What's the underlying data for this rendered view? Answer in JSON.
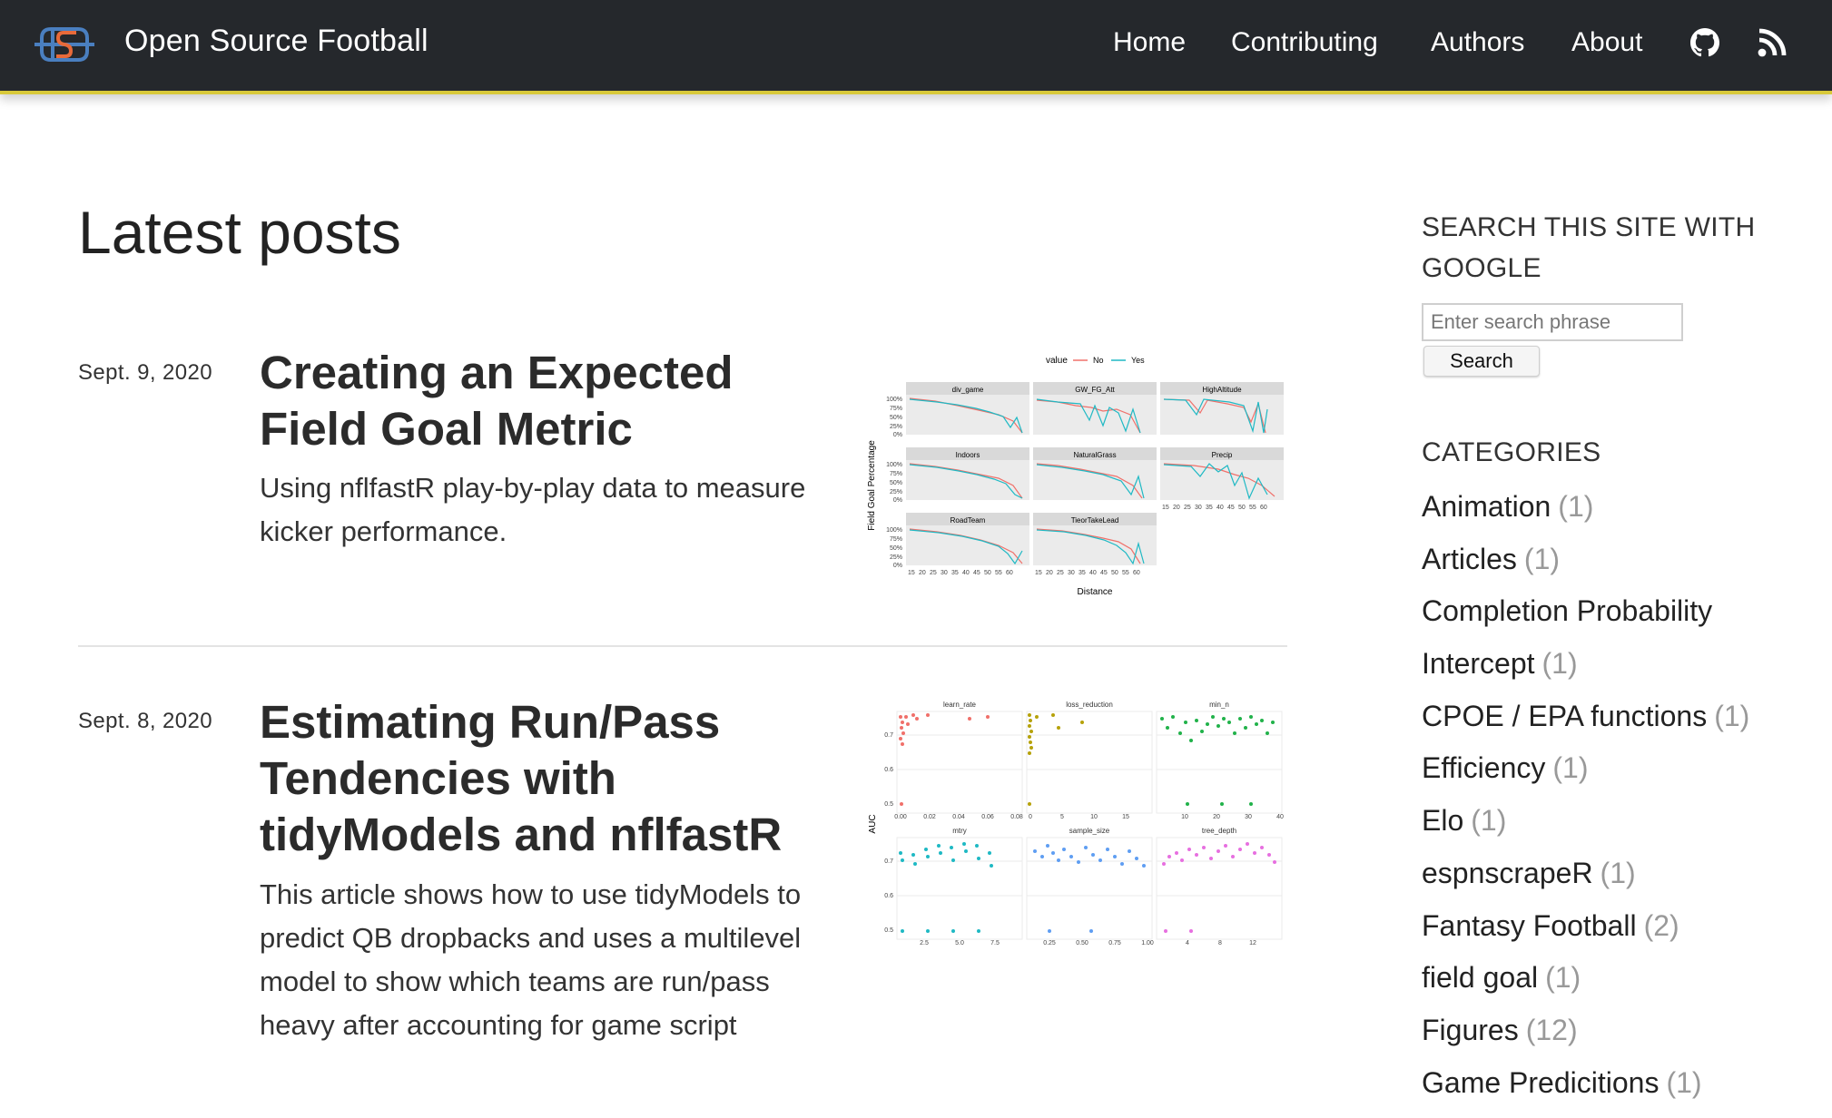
{
  "header": {
    "site_title": "Open Source Football",
    "nav": [
      "Home",
      "Contributing",
      "Authors",
      "About"
    ],
    "icons": [
      "github-icon",
      "rss-icon"
    ],
    "colors": {
      "bar": "#25282c",
      "accent": "#d8c93a",
      "logo_blue": "#4a7fc0",
      "logo_orange": "#e86a3a"
    }
  },
  "main": {
    "heading": "Latest posts",
    "posts": [
      {
        "date": "Sept. 9, 2020",
        "title": "Creating an Expected Field Goal Metric",
        "description": "Using nflfastR play-by-play data to measure kicker performance.",
        "thumbnail": {
          "legend_title": "value",
          "legend": [
            "No",
            "Yes"
          ],
          "panels": [
            "div_game",
            "GW_FG_Att",
            "HighAltitude",
            "Indoors",
            "NaturalGrass",
            "Precip",
            "RoadTeam",
            "TieorTakeLead"
          ],
          "y_ticks": [
            "100%",
            "75%",
            "50%",
            "25%",
            "0%"
          ],
          "x_ticks": [
            "15",
            "20",
            "25",
            "30",
            "35",
            "40",
            "45",
            "50",
            "55",
            "60"
          ],
          "xlabel": "Distance",
          "ylabel": "Field Goal Percentage"
        }
      },
      {
        "date": "Sept. 8, 2020",
        "title": "Estimating Run/Pass Tendencies with tidyModels and nflfastR",
        "description": "This article shows how to use tidyModels to predict QB dropbacks and uses a multilevel model to show which teams are run/pass heavy after accounting for game script",
        "thumbnail": {
          "ylabel": "AUC",
          "y_ticks": [
            "0.7",
            "0.6",
            "0.5"
          ],
          "panels": [
            {
              "name": "learn_rate",
              "x_ticks": [
                "0.00",
                "0.02",
                "0.04",
                "0.06",
                "0.08"
              ],
              "color": "#f0706a"
            },
            {
              "name": "loss_reduction",
              "x_ticks": [
                "0",
                "5",
                "10",
                "15"
              ],
              "color": "#b6a20a"
            },
            {
              "name": "min_n",
              "x_ticks": [
                "10",
                "20",
                "30",
                "40"
              ],
              "color": "#21b24a"
            },
            {
              "name": "mtry",
              "x_ticks": [
                "2.5",
                "5.0",
                "7.5"
              ],
              "color": "#1fb9c4"
            },
            {
              "name": "sample_size",
              "x_ticks": [
                "0.25",
                "0.50",
                "0.75",
                "1.00"
              ],
              "color": "#5f9ef2"
            },
            {
              "name": "tree_depth",
              "x_ticks": [
                "4",
                "8",
                "12"
              ],
              "color": "#e76fe0"
            }
          ]
        }
      }
    ]
  },
  "sidebar": {
    "search_heading": "SEARCH THIS SITE WITH GOOGLE",
    "search_placeholder": "Enter search phrase",
    "search_button": "Search",
    "categories_heading": "CATEGORIES",
    "categories": [
      {
        "name": "Animation",
        "count": "(1)"
      },
      {
        "name": "Articles",
        "count": "(1)"
      },
      {
        "name": "Completion Probability",
        "count": ""
      },
      {
        "name": "Intercept",
        "count": "(1)"
      },
      {
        "name": "CPOE / EPA functions",
        "count": "(1)"
      },
      {
        "name": "Efficiency",
        "count": "(1)"
      },
      {
        "name": "Elo",
        "count": "(1)"
      },
      {
        "name": "espnscrapeR",
        "count": "(1)"
      },
      {
        "name": "Fantasy Football",
        "count": "(2)"
      },
      {
        "name": "field goal",
        "count": "(1)"
      },
      {
        "name": "Figures",
        "count": "(12)"
      },
      {
        "name": "Game Predicitions",
        "count": "(1)"
      }
    ]
  }
}
